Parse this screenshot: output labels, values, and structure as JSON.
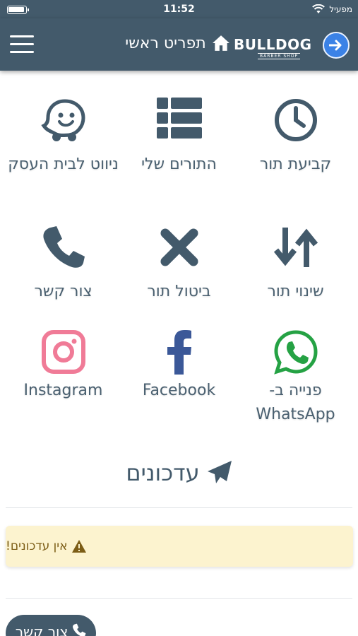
{
  "status_bar": {
    "time": "11:52",
    "carrier": "מפעיל"
  },
  "header": {
    "title": "תפריט ראשי",
    "logo_text": "BULLDOG",
    "logo_sub": "BARBER SHOP",
    "menu_icon": "hamburger-icon",
    "forward_icon": "arrow-right-icon"
  },
  "tiles": [
    {
      "label": "קביעת תור",
      "icon": "clock-icon"
    },
    {
      "label": "התורים שלי",
      "icon": "list-icon"
    },
    {
      "label": "ניווט לבית העסק",
      "icon": "waze-icon"
    },
    {
      "label": "שינוי תור",
      "icon": "sort-arrows-icon"
    },
    {
      "label": "ביטול תור",
      "icon": "x-icon"
    },
    {
      "label": "צור קשר",
      "icon": "phone-icon"
    },
    {
      "label": "פנייה ב- WhatsApp",
      "icon": "whatsapp-icon"
    },
    {
      "label": "Facebook",
      "icon": "facebook-icon"
    },
    {
      "label": "Instagram",
      "icon": "instagram-icon"
    }
  ],
  "updates": {
    "title": "עדכונים",
    "empty_message": "אין עדכונים!"
  },
  "contact_button": {
    "label": "צור קשר"
  },
  "colors": {
    "primary": "#435a6b",
    "accent_blue": "#3b82e6",
    "whatsapp": "#25a244",
    "facebook": "#3b5898",
    "instagram": "#f07b97",
    "alert_bg": "#fcf3cf",
    "alert_text": "#7c5d16"
  }
}
